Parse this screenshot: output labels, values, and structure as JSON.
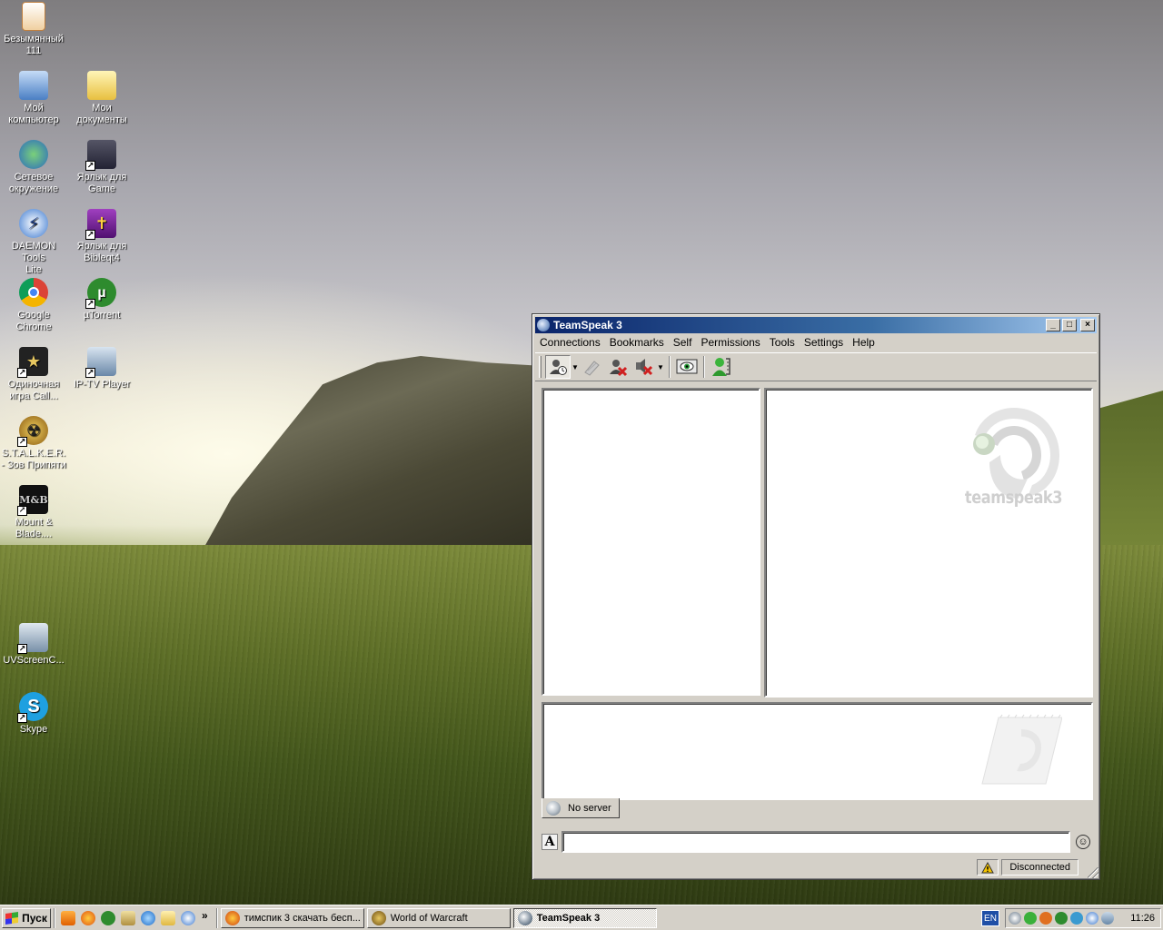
{
  "desktop": {
    "icons": [
      {
        "label": "Безымянный\n111",
        "icon": "image-file-icon"
      },
      {
        "label": "Мой\nкомпьютер",
        "icon": "my-computer-icon"
      },
      {
        "label": "Мои\nдокументы",
        "icon": "my-documents-icon"
      },
      {
        "label": "Сетевое\nокружение",
        "icon": "network-icon"
      },
      {
        "label": "Ярлык для\nGame",
        "icon": "game-shortcut-icon"
      },
      {
        "label": "DAEMON Tools\nLite",
        "icon": "daemon-tools-icon"
      },
      {
        "label": "Ярлык для\nBibleqt4",
        "icon": "bible-icon"
      },
      {
        "label": "Google\nChrome",
        "icon": "chrome-icon"
      },
      {
        "label": "µTorrent",
        "icon": "utorrent-icon"
      },
      {
        "label": "Одиночная\nигра Call...",
        "icon": "call-of-duty-icon"
      },
      {
        "label": "IP-TV Player",
        "icon": "iptv-icon"
      },
      {
        "label": "S.T.A.L.K.E.R.\n- Зов Припяти",
        "icon": "stalker-icon"
      },
      {
        "label": "Mount &\nBlade....",
        "icon": "mount-blade-icon"
      },
      {
        "label": "UVScreenC...",
        "icon": "uvscreen-icon"
      },
      {
        "label": "Skype",
        "icon": "skype-icon"
      }
    ]
  },
  "window": {
    "title": "TeamSpeak 3",
    "controls": {
      "minimize": "_",
      "maximize": "□",
      "close": "×"
    },
    "menu": [
      "Connections",
      "Bookmarks",
      "Self",
      "Permissions",
      "Tools",
      "Settings",
      "Help"
    ],
    "toolbar": [
      "connect-icon",
      "disconnect-icon",
      "away-icon",
      "mute-icon",
      "view-icon",
      "identity-icon"
    ],
    "logo_text": "teamspeak3",
    "tab_label": "No server",
    "chat_input": {
      "value": "",
      "placeholder": ""
    },
    "format_button": "A",
    "smiley": "☺",
    "status_text": "Disconnected"
  },
  "taskbar": {
    "start_label": "Пуск",
    "chevron": "»",
    "tasks": [
      {
        "label": "тимспик 3 скачать бесп...",
        "icon": "firefox-icon"
      },
      {
        "label": "World of Warcraft",
        "icon": "wow-icon"
      },
      {
        "label": "TeamSpeak 3",
        "icon": "teamspeak-icon"
      }
    ],
    "language": "EN",
    "clock": "11:26"
  },
  "colors": {
    "title_start": "#0a246a",
    "title_end": "#a6caf0",
    "window_bg": "#d4d0c8"
  }
}
